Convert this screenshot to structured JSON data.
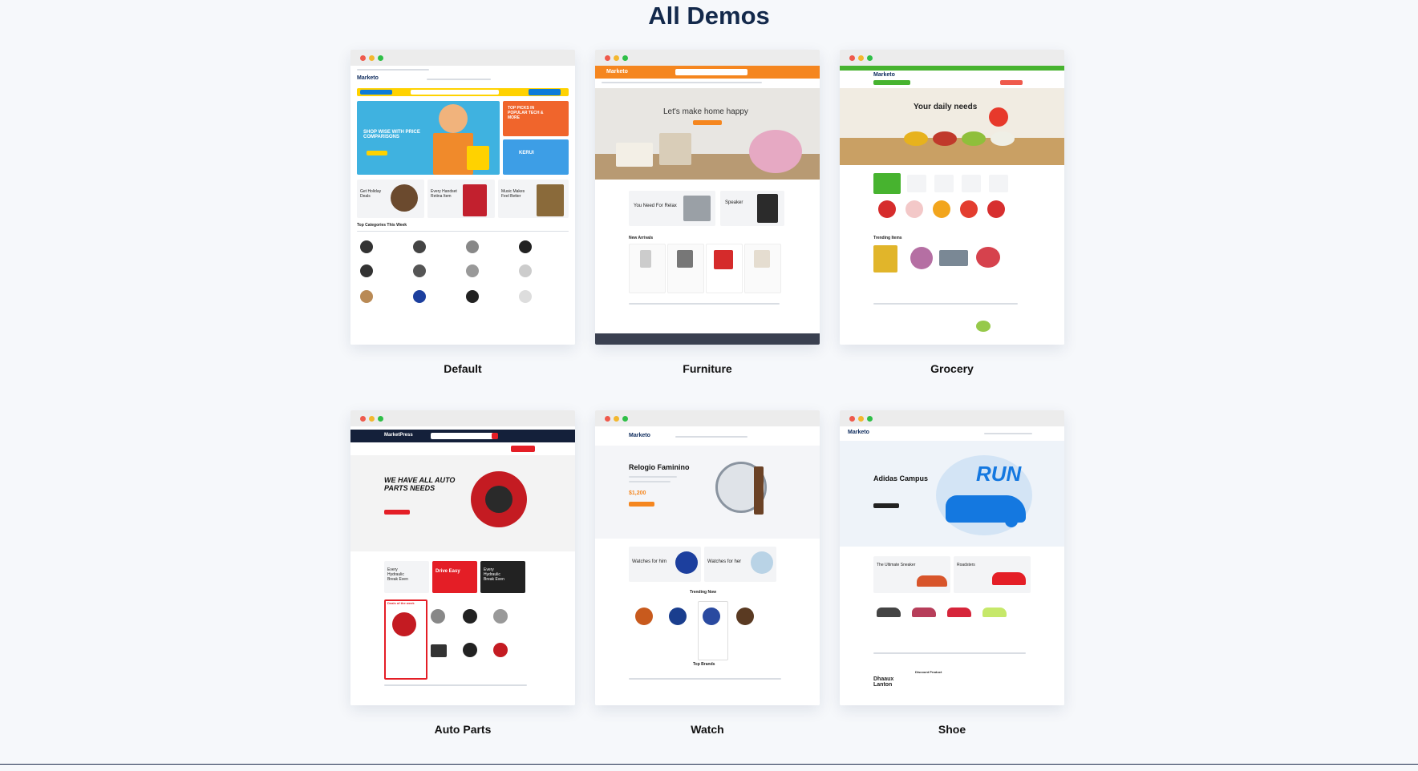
{
  "section": {
    "title": "All Demos"
  },
  "demos": [
    {
      "label": "Default",
      "shot": {
        "logo": "Marketo",
        "search_button": "All Categories",
        "banner_headline": "SHOP WISE WITH PRICE COMPARISONS",
        "side_promo_1": "TOP PICKS IN POPULAR TECH & MORE",
        "side_promo_2": "KERUI",
        "promo_1": "Get Holiday Deals",
        "promo_2": "Every Handset Retina Item",
        "promo_3": "Music Makes Feel Better",
        "section_heading": "Top Categories This Week",
        "accent": "#ffd200",
        "secondary": "#0c7bd8"
      }
    },
    {
      "label": "Furniture",
      "shot": {
        "logo": "Marketo",
        "hero_text": "Let's make home happy",
        "promo_1": "You Need For Relax",
        "promo_2": "Speaker",
        "section_heading": "New Arrivals",
        "accent": "#f5861f"
      }
    },
    {
      "label": "Grocery",
      "shot": {
        "logo": "Marketo",
        "hero_text": "Your daily needs",
        "section_heading": "Trending Items",
        "accent": "#47b32f",
        "secondary": "#ef5a4c"
      }
    },
    {
      "label": "Auto Parts",
      "shot": {
        "logo": "MarketPress",
        "hero_text": "WE HAVE ALL AUTO PARTS NEEDS",
        "promo_1": "Every Hydraulic Break Even",
        "promo_2": "Drive Easy",
        "promo_3": "Every Hydraulic Break Even",
        "section_heading": "Deals of the week",
        "accent": "#e41e26",
        "header_bg": "#14203a"
      }
    },
    {
      "label": "Watch",
      "shot": {
        "logo": "Marketo",
        "hero_title": "Relogio Faminino",
        "hero_price": "$1,200",
        "promo_1": "Watches for him",
        "promo_2": "Watches for her",
        "section_heading": "Trending Now",
        "brands_heading": "Top Brands",
        "accent": "#f5861f"
      }
    },
    {
      "label": "Shoe",
      "shot": {
        "logo": "Marketo",
        "hero_title": "Adidas Campus",
        "hero_word": "RUN",
        "promo_1": "The Ultimate Sneaker",
        "promo_2": "Roadsters",
        "section_heading": "Discount Product",
        "bottom_text": "Dhaaux Lanton",
        "accent": "#e41e26",
        "secondary": "#1478e0"
      }
    }
  ]
}
